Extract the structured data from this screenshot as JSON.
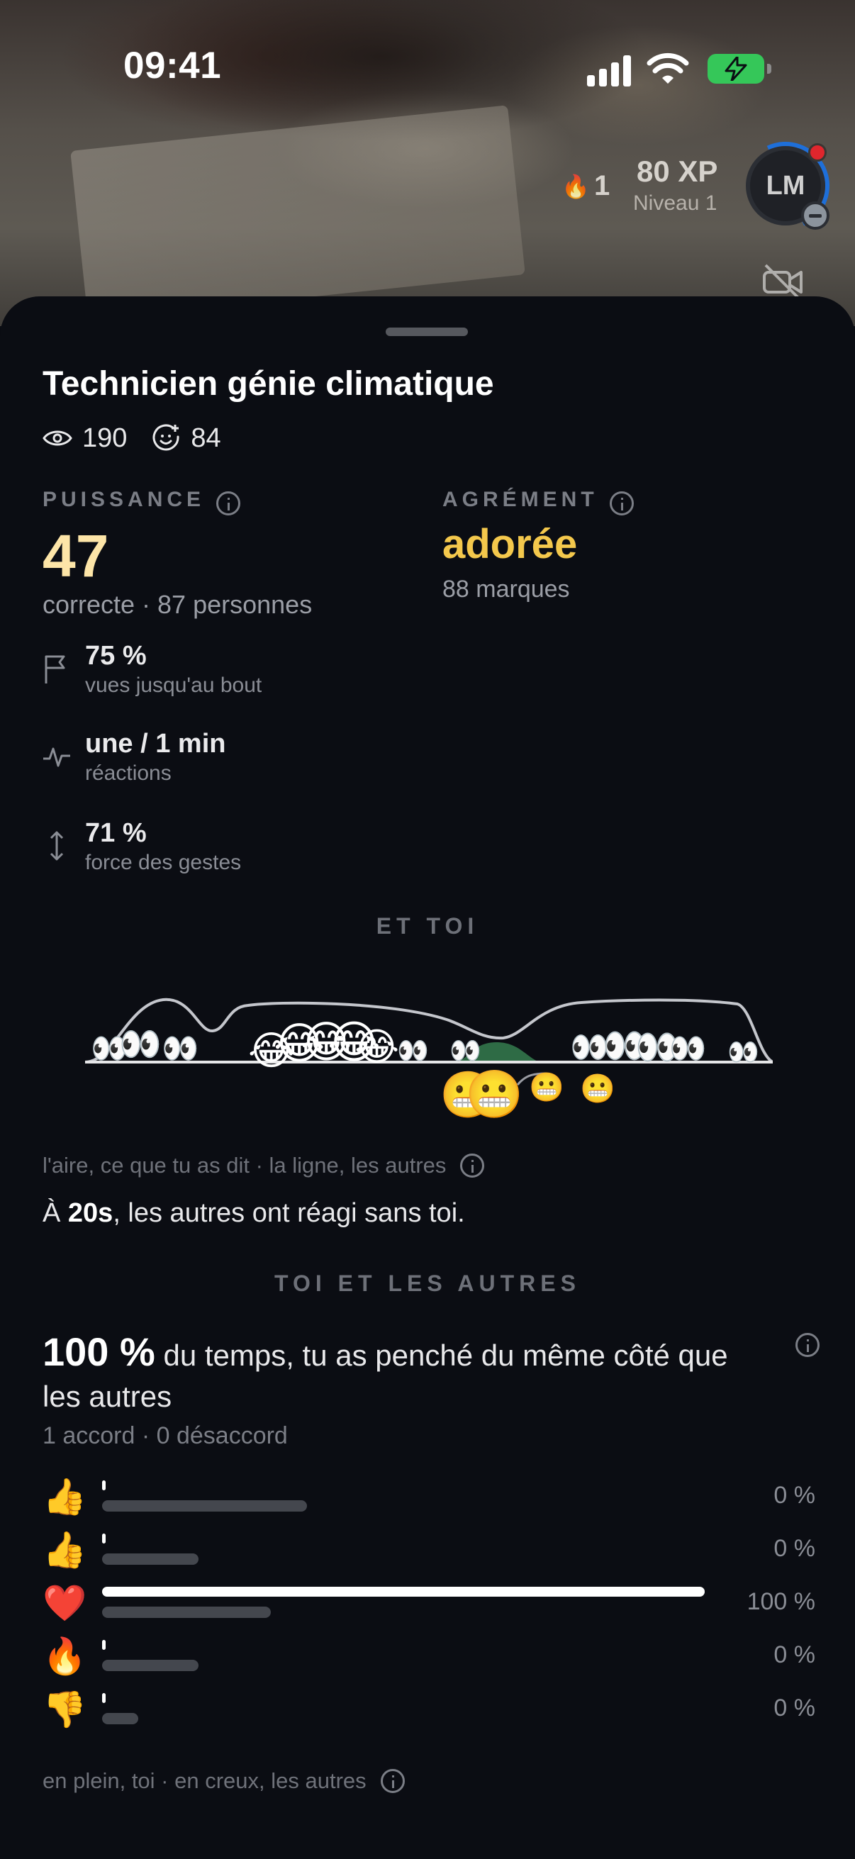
{
  "status_bar": {
    "time": "09:41"
  },
  "hud": {
    "streak": "1",
    "xp": "80 XP",
    "level": "Niveau 1",
    "avatar_initials": "LM"
  },
  "sheet": {
    "title": "Technicien génie climatique",
    "views": "190",
    "reactions": "84",
    "puissance": {
      "label": "PUISSANCE",
      "value": "47",
      "subtitle": "correcte · 87 personnes"
    },
    "agrement": {
      "label": "AGRÉMENT",
      "value": "adorée",
      "subtitle": "88 marques"
    },
    "stats": [
      {
        "icon": "flag-icon",
        "value": "75 %",
        "desc": "vues jusqu'au bout"
      },
      {
        "icon": "pulse-icon",
        "value": "une / 1 min",
        "desc": "réactions"
      },
      {
        "icon": "vertical-arrows-icon",
        "value": "71 %",
        "desc": "force des gestes"
      }
    ],
    "et_toi": {
      "heading": "ET TOI",
      "legend": "l'aire, ce que tu as dit · la ligne, les autres",
      "statement_prefix": "À ",
      "statement_time": "20s",
      "statement_suffix": ", les autres ont réagi sans toi."
    },
    "toi_et_autres": {
      "heading": "TOI ET LES AUTRES",
      "percent": "100 %",
      "percent_text": " du temps, tu as penché du même côté que les autres",
      "accord": "1 accord · 0 désaccord",
      "reactions": [
        {
          "emoji": "👍",
          "me": 0,
          "others": 0.34,
          "pct": "0 %"
        },
        {
          "emoji": "👍",
          "me": 0,
          "others": 0.16,
          "pct": "0 %"
        },
        {
          "emoji": "❤️",
          "me": 1.0,
          "others": 0.28,
          "pct": "100 %"
        },
        {
          "emoji": "🔥",
          "me": 0,
          "others": 0.16,
          "pct": "0 %"
        },
        {
          "emoji": "👎",
          "me": 0,
          "others": 0.06,
          "pct": "0 %"
        }
      ],
      "legend": "en plein, toi · en creux, les autres"
    }
  },
  "colors": {
    "accent_gold": "#f4c84c",
    "value_cream": "#fde5a8",
    "area_green": "#2e6b45",
    "battery_green": "#35c759",
    "notif_red": "#e0262d"
  }
}
